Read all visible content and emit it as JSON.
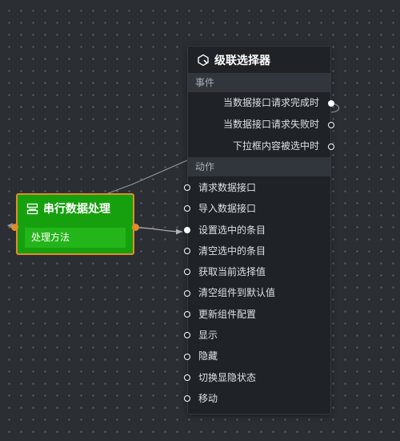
{
  "canvas": {
    "background": "#2b2e33",
    "wire_color": "#8f949b"
  },
  "cascader_node": {
    "icon": "cascader-icon",
    "title": "级联选择器",
    "events_label": "事件",
    "events": [
      {
        "label": "当数据接口请求完成时",
        "connected": true
      },
      {
        "label": "当数据接口请求失败时",
        "connected": false
      },
      {
        "label": "下拉框内容被选中时",
        "connected": false
      }
    ],
    "actions_label": "动作",
    "actions": [
      {
        "label": "请求数据接口",
        "connected": false
      },
      {
        "label": "导入数据接口",
        "connected": false
      },
      {
        "label": "设置选中的条目",
        "connected": true
      },
      {
        "label": "清空选中的条目",
        "connected": false
      },
      {
        "label": "获取当前选择值",
        "connected": false
      },
      {
        "label": "清空组件到默认值",
        "connected": false
      },
      {
        "label": "更新组件配置",
        "connected": false
      },
      {
        "label": "显示",
        "connected": false
      },
      {
        "label": "隐藏",
        "connected": false
      },
      {
        "label": "切换显隐状态",
        "connected": false
      },
      {
        "label": "移动",
        "connected": false
      }
    ]
  },
  "serial_node": {
    "icon": "serial-process-icon",
    "title": "串行数据处理",
    "method_label": "处理方法",
    "color": "#16a00e",
    "selected_border": "#e38b2c"
  }
}
